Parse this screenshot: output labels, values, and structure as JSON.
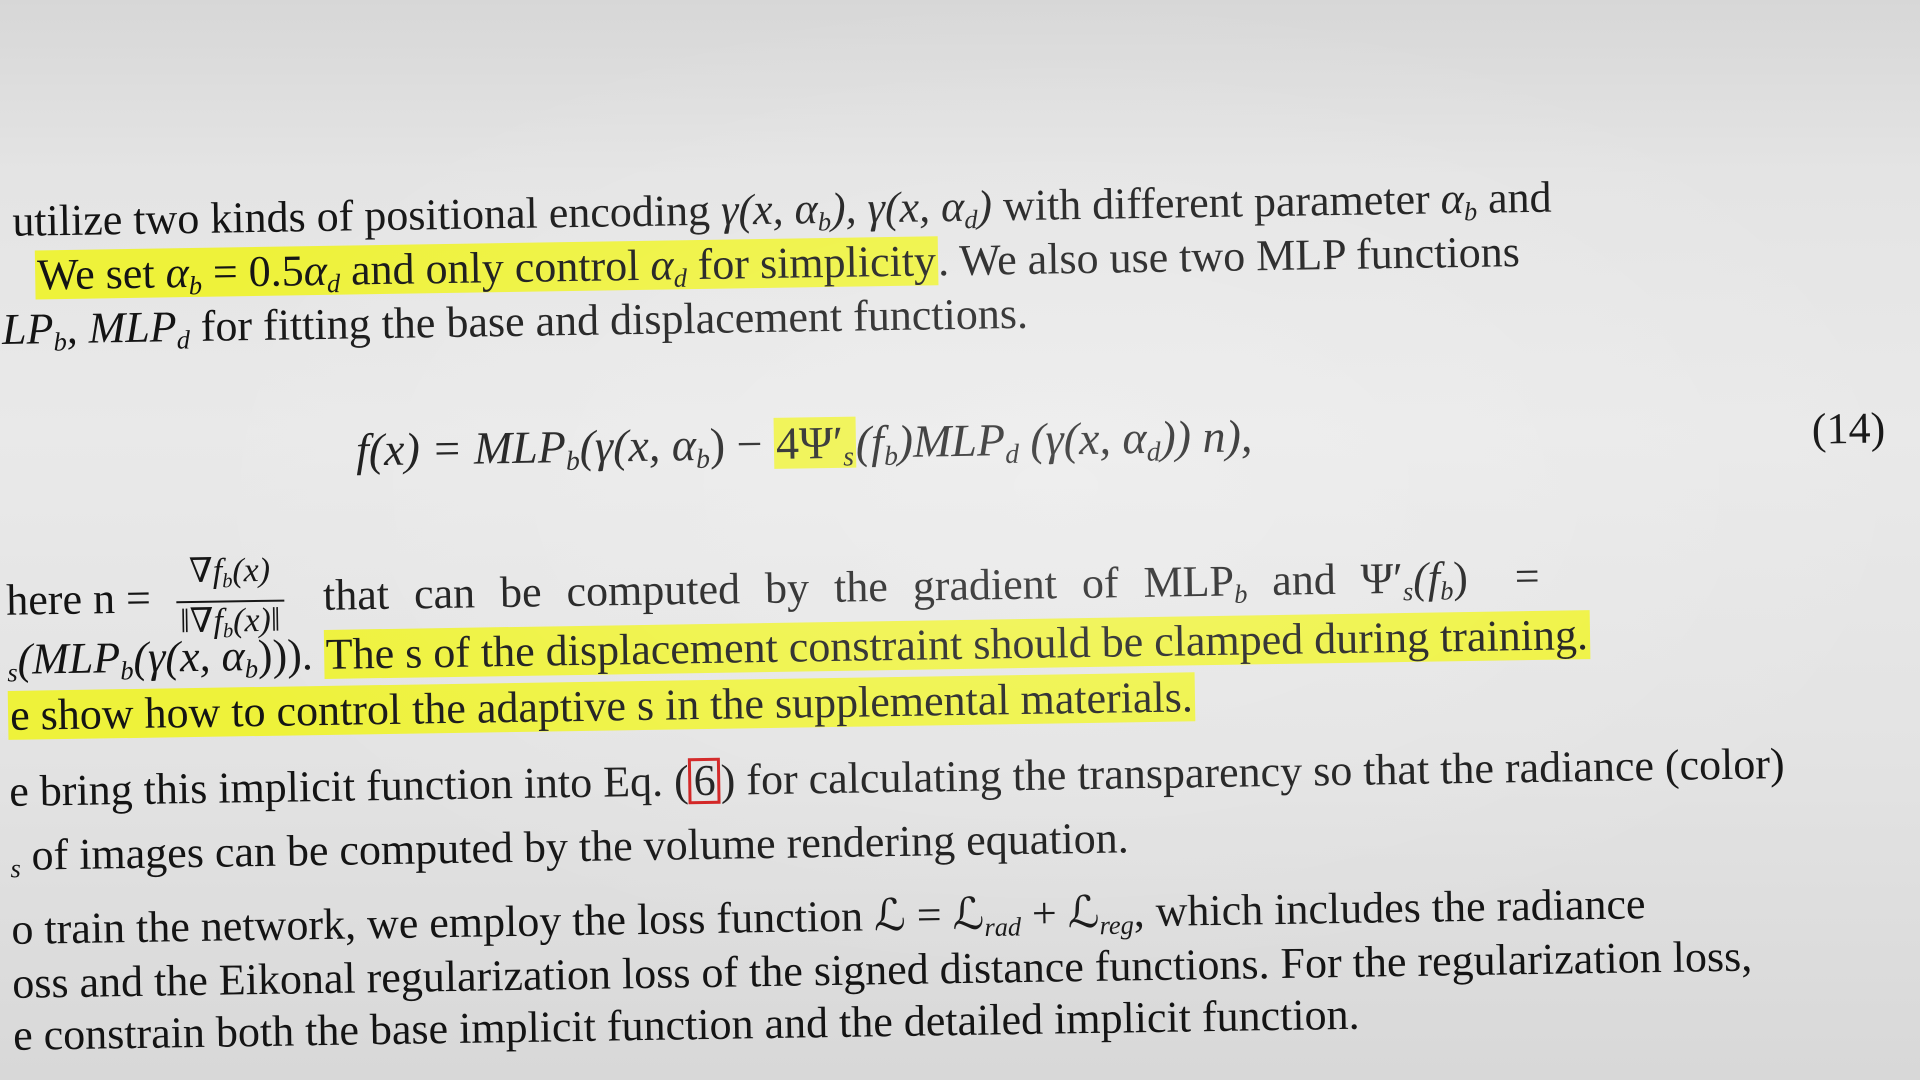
{
  "lines": {
    "l1": {
      "a": "utilize two kinds of positional encoding ",
      "b": " with different parameter ",
      "c": " and"
    },
    "l2": {
      "hl_a": "We set ",
      "hl_b": " = 0.5",
      "hl_c": " and only control ",
      "hl_d": " for simplicity",
      "b": ". We also use two MLP functions"
    },
    "l3": {
      "a": "LP",
      "b": ", MLP",
      "c": " for fitting the base and displacement functions."
    },
    "equation": {
      "lhs": "f(x) = MLP",
      "mid": "(γ(x, α",
      "minus": ") − ",
      "hl": "4Ψ′",
      "rest": "(f",
      "rest2": ")MLP",
      "rest3": " (γ(x, α",
      "rest4": ")) n),",
      "number": "(14)"
    },
    "l5": {
      "a": "here n = ",
      "frac_num": "∇f",
      "frac_num2": "(x)",
      "frac_den": "‖∇f",
      "frac_den2": "(x)‖",
      "b": " that can be computed by the gradient of MLP",
      "c": " and Ψ′",
      "d": "(f",
      "e": ") ="
    },
    "l6": {
      "a": "(MLP",
      "b": "(γ(x, α",
      "c": "))). ",
      "hl": "The s of the displacement constraint should be clamped during training."
    },
    "l7": {
      "hl": "e show how to control the adaptive s in the supplemental materials."
    },
    "l8": {
      "a": "e bring this implicit function into Eq. ",
      "ref": "6",
      "b": " for calculating the transparency so that the radiance (color)"
    },
    "l9": {
      "a": " of images can be computed by the volume rendering equation."
    },
    "l10": {
      "a": "o train the network, we employ the loss function ℒ = ℒ",
      "b": " + ℒ",
      "c": ", which includes the radiance"
    },
    "l11": {
      "a": "oss and the Eikonal regularization loss of the signed distance functions. For the regularization loss,"
    },
    "l12": {
      "a": "e constrain both the base implicit function and the detailed implicit function."
    }
  },
  "symbols": {
    "gamma_x_ab": "γ(x, α",
    "gamma_x_ad": "), γ(x, α",
    "close": ")",
    "alpha": "α",
    "sub_b": "b",
    "sub_d": "d",
    "sub_s": "s",
    "sub_rad": "rad",
    "sub_reg": "reg",
    "prime_s": "s"
  },
  "colors": {
    "highlight": "#eef23a",
    "reference_box": "#d01818",
    "text": "#141414"
  }
}
